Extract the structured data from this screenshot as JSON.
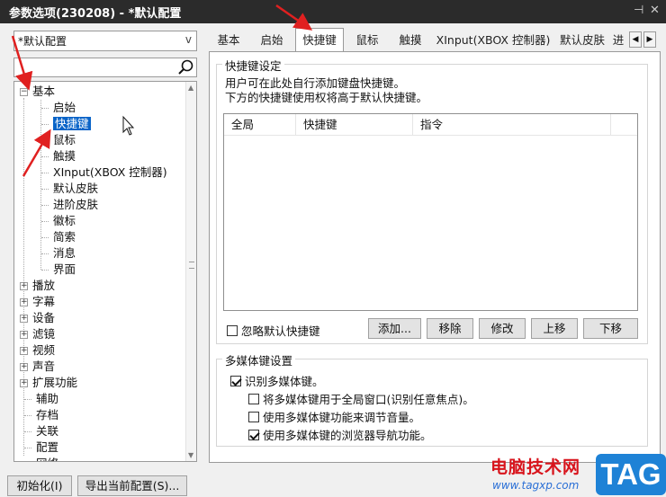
{
  "window": {
    "title": "参数选项(230208) - *默认配置",
    "pin_glyph": "⊣",
    "close_glyph": "✕"
  },
  "profile_select": {
    "value": "*默认配置"
  },
  "tree": {
    "root_expanded": "基本",
    "children": [
      "启始",
      "快捷键",
      "鼠标",
      "触摸",
      "XInput(XBOX 控制器)",
      "默认皮肤",
      "进阶皮肤",
      "徽标",
      "简索",
      "消息",
      "界面"
    ],
    "selected": "快捷键",
    "collapsed_groups": [
      "播放",
      "字幕",
      "设备",
      "滤镜",
      "视频",
      "声音",
      "扩展功能"
    ],
    "leaf_items": [
      "辅助",
      "存档",
      "关联",
      "配置",
      "网络"
    ]
  },
  "tabs": [
    "基本",
    "启始",
    "快捷键",
    "鼠标",
    "触摸",
    "XInput(XBOX 控制器)",
    "默认皮肤",
    "进"
  ],
  "active_tab": "快捷键",
  "hotkeys": {
    "group_title": "快捷键设定",
    "desc1": "用户可在此处自行添加键盘快捷键。",
    "desc2": "下方的快捷键使用权将高于默认快捷键。",
    "columns": [
      "全局",
      "快捷键",
      "指令"
    ],
    "ignore_default_label": "忽略默认快捷键",
    "ignore_default_checked": false,
    "buttons": {
      "add": "添加...",
      "remove": "移除",
      "modify": "修改",
      "up": "上移",
      "down": "下移"
    }
  },
  "multimedia": {
    "group_title": "多媒体键设置",
    "options": [
      {
        "label": "识别多媒体键。",
        "checked": true
      },
      {
        "label": "将多媒体键用于全局窗口(识别任意焦点)。",
        "checked": false
      },
      {
        "label": "使用多媒体键功能来调节音量。",
        "checked": false
      },
      {
        "label": "使用多媒体键的浏览器导航功能。",
        "checked": true
      }
    ]
  },
  "bottom_buttons": {
    "init": "初始化(I)",
    "export": "导出当前配置(S)..."
  },
  "watermark": {
    "site_name": "电脑技术网",
    "url": "www.tagxp.com",
    "badge": "TAG"
  },
  "colors": {
    "titlebar": "#2b2b2b",
    "selection": "#0a64c8",
    "annotation_arrow": "#e02020"
  }
}
